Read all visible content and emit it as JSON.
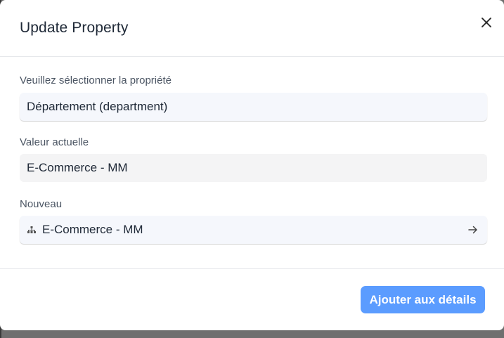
{
  "dialog": {
    "title": "Update Property",
    "close_icon": "close-icon"
  },
  "property_select": {
    "label": "Veuillez sélectionner la propriété",
    "value": "Département (department)"
  },
  "current_value": {
    "label": "Valeur actuelle",
    "value": "E-Commerce - MM"
  },
  "new_value": {
    "label": "Nouveau",
    "value": "E-Commerce - MM",
    "leading_icon": "hierarchy-icon",
    "trailing_icon": "arrow-right-icon"
  },
  "footer": {
    "submit_label": "Ajouter aux détails"
  },
  "colors": {
    "primary": "#5b9cff",
    "field_bg": "#f5f7fc",
    "readonly_bg": "#f4f4f5",
    "text": "#1f2937",
    "label": "#4b5563"
  }
}
